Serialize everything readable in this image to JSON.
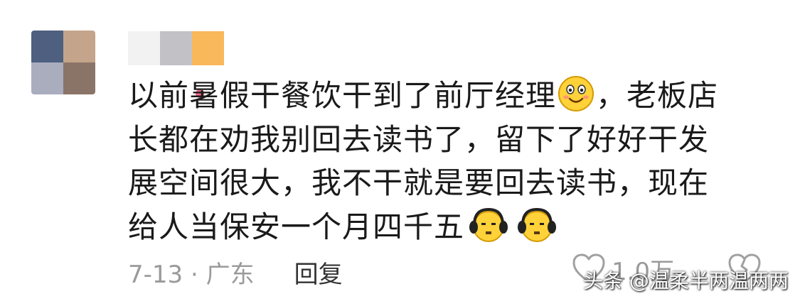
{
  "avatar": {
    "pixels": [
      "#4e5f80",
      "#c4a48a",
      "#a9adbe",
      "#8a7468"
    ]
  },
  "username": {
    "blocks": [
      "#f2f2f2",
      "#c2c2c6",
      "#f9b85a"
    ],
    "dot_color": "#f06a8a"
  },
  "comment": {
    "line1_text": "以前暑假干餐饮干到了前厅经理",
    "line1_tail": "，老板店",
    "line2": "长都在劝我别回去读书了，留下了好好干发",
    "line3": "展空间很大，我不干就是要回去读书，现在",
    "line4": "给人当保安一个月四千五",
    "emoji_1": "smile-icon",
    "emoji_2": "headphones-face-icon"
  },
  "meta": {
    "date_location": "7-13 · 广东",
    "reply_label": "回复",
    "like_count": "1.0万"
  },
  "watermark": {
    "text": "头条 @温柔半两温两两"
  }
}
